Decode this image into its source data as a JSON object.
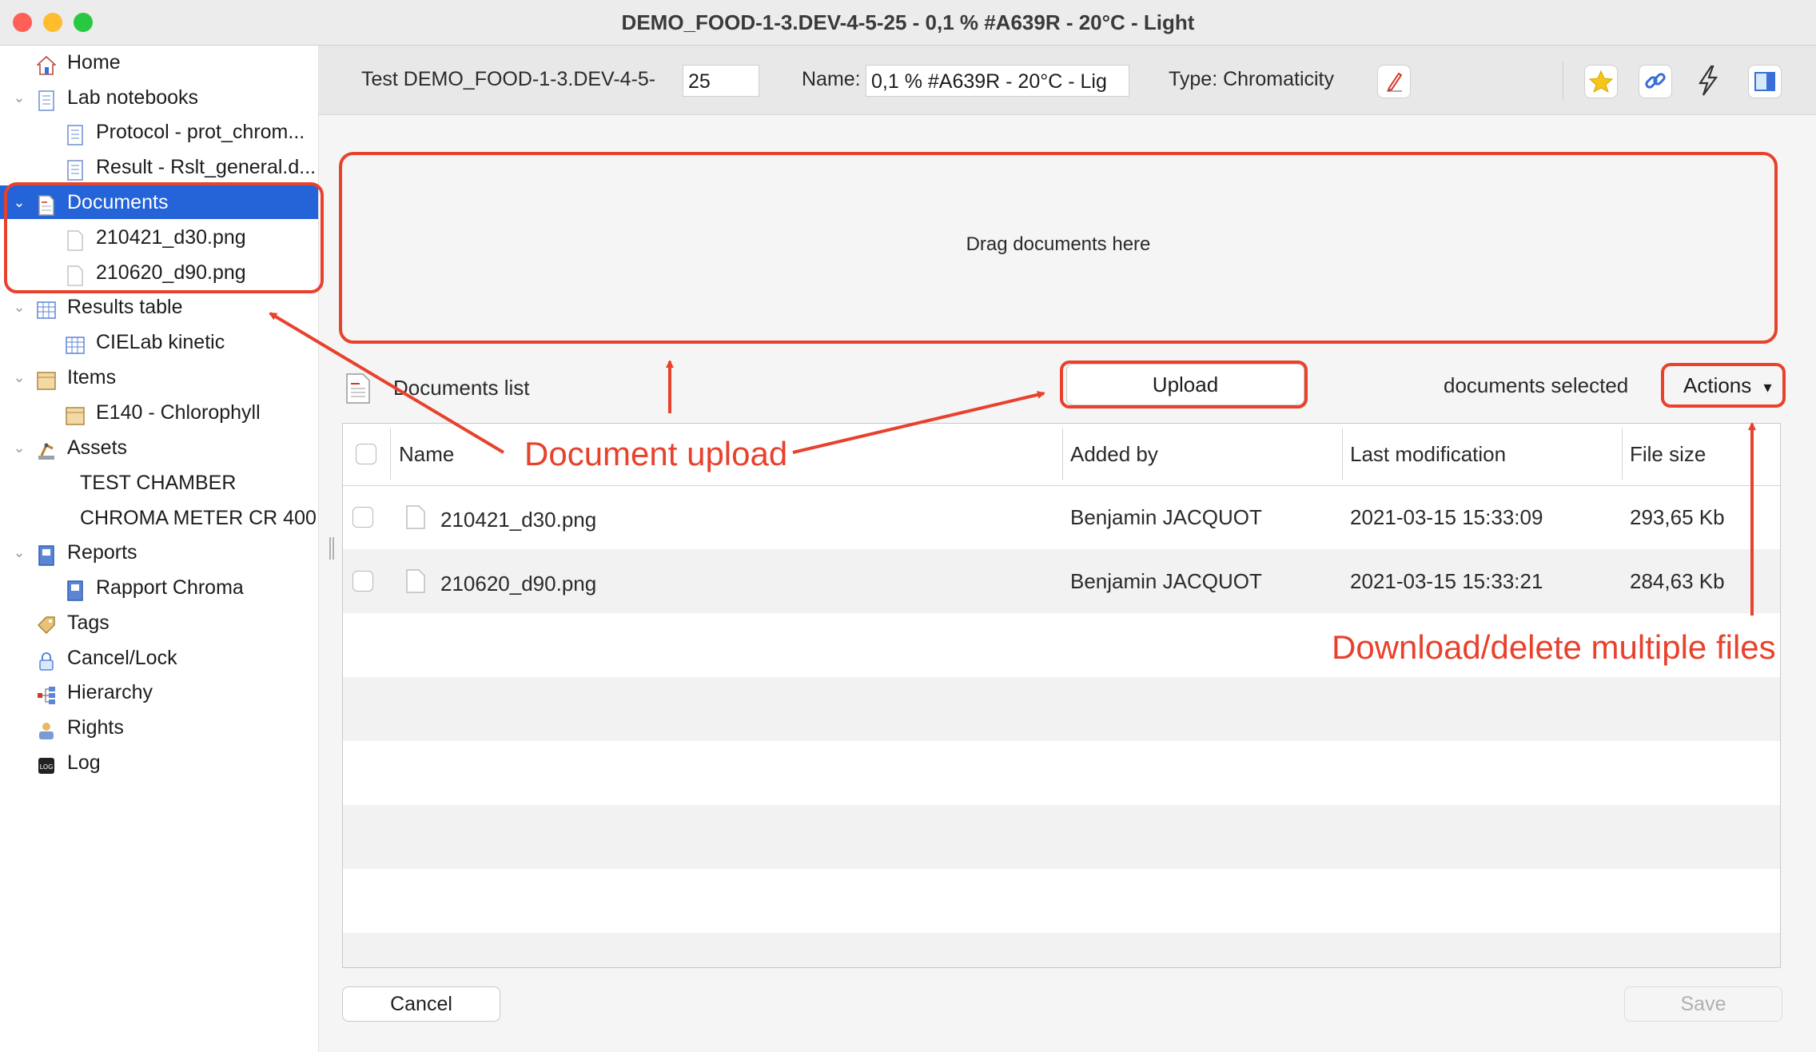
{
  "window": {
    "title": "DEMO_FOOD-1-3.DEV-4-5-25 - 0,1 % #A639R - 20°C - Light"
  },
  "sidebar": {
    "items": [
      {
        "label": "Home",
        "icon": "home-icon",
        "chevron": ""
      },
      {
        "label": "Lab notebooks",
        "icon": "notebook-icon",
        "chevron": "⌄"
      },
      {
        "label": "Protocol - prot_chrom...",
        "icon": "protocol-icon",
        "chevron": ""
      },
      {
        "label": "Result - Rslt_general.d...",
        "icon": "result-icon",
        "chevron": ""
      },
      {
        "label": "Documents",
        "icon": "documents-icon",
        "chevron": "⌄"
      },
      {
        "label": "210421_d30.png",
        "icon": "file-icon",
        "chevron": ""
      },
      {
        "label": "210620_d90.png",
        "icon": "file-icon",
        "chevron": ""
      },
      {
        "label": "Results table",
        "icon": "table-icon",
        "chevron": "⌄"
      },
      {
        "label": "CIELab kinetic",
        "icon": "table-icon",
        "chevron": ""
      },
      {
        "label": "Items",
        "icon": "box-icon",
        "chevron": "⌄"
      },
      {
        "label": "E140 - Chlorophyll",
        "icon": "box-icon",
        "chevron": ""
      },
      {
        "label": "Assets",
        "icon": "assets-icon",
        "chevron": "⌄"
      },
      {
        "label": "TEST CHAMBER",
        "icon": "",
        "chevron": ""
      },
      {
        "label": "CHROMA METER CR 400",
        "icon": "",
        "chevron": ""
      },
      {
        "label": "Reports",
        "icon": "report-icon",
        "chevron": "⌄"
      },
      {
        "label": "Rapport Chroma",
        "icon": "report-icon",
        "chevron": ""
      },
      {
        "label": "Tags",
        "icon": "tag-icon",
        "chevron": ""
      },
      {
        "label": "Cancel/Lock",
        "icon": "lock-icon",
        "chevron": ""
      },
      {
        "label": "Hierarchy",
        "icon": "hierarchy-icon",
        "chevron": ""
      },
      {
        "label": "Rights",
        "icon": "rights-icon",
        "chevron": ""
      },
      {
        "label": "Log",
        "icon": "log-icon",
        "chevron": ""
      }
    ],
    "selected": "Documents"
  },
  "toolbar": {
    "test_label": "Test DEMO_FOOD-1-3.DEV-4-5-",
    "test_value": "25",
    "name_label": "Name:",
    "name_value": "0,1 % #A639R - 20°C - Lig",
    "type_label": "Type: Chromaticity",
    "icons": [
      "edit-icon",
      "star-icon",
      "link-icon",
      "lightning-icon",
      "panel-icon"
    ]
  },
  "dropzone": {
    "label": "Drag documents here"
  },
  "documents": {
    "list_label": "Documents list",
    "upload_label": "Upload",
    "selected_label": "documents selected",
    "actions_label": "Actions",
    "actions_caret": "▾",
    "columns": [
      "Name",
      "Added by",
      "Last modification",
      "File size"
    ],
    "rows": [
      {
        "name": "210421_d30.png",
        "added_by": "Benjamin JACQUOT",
        "modified": "2021-03-15 15:33:09",
        "size": "293,65 Kb"
      },
      {
        "name": "210620_d90.png",
        "added_by": "Benjamin JACQUOT",
        "modified": "2021-03-15 15:33:21",
        "size": "284,63 Kb"
      }
    ]
  },
  "footer": {
    "cancel_label": "Cancel",
    "save_label": "Save"
  },
  "annotations": {
    "document_upload": "Document upload",
    "download_delete": "Download/delete multiple files",
    "color": "#e8412c"
  },
  "colors": {
    "selection": "#2563d8",
    "annotation": "#e8412c"
  }
}
